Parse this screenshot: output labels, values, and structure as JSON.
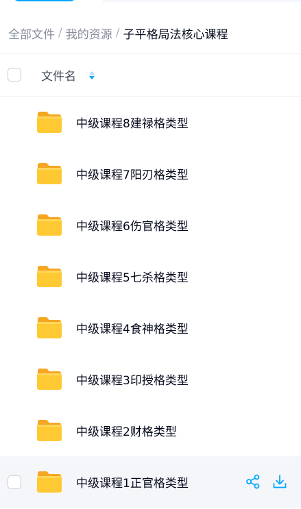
{
  "breadcrumb": {
    "items": [
      "全部文件",
      "我的资源"
    ],
    "separator": "/",
    "current": "子平格局法核心课程"
  },
  "header": {
    "column_name": "文件名"
  },
  "files": [
    {
      "name": "中级课程8建禄格类型"
    },
    {
      "name": "中级课程7阳刃格类型"
    },
    {
      "name": "中级课程6伤官格类型"
    },
    {
      "name": "中级课程5七杀格类型"
    },
    {
      "name": "中级课程4食神格类型"
    },
    {
      "name": "中级课程3印授格类型"
    },
    {
      "name": "中级课程2财格类型"
    },
    {
      "name": "中级课程1正官格类型"
    }
  ],
  "row_actions": [
    "share-icon",
    "download-icon"
  ],
  "colors": {
    "accent": "#06a7ff",
    "folder": "#ffc933",
    "hover_row": "#f5f6fa"
  }
}
